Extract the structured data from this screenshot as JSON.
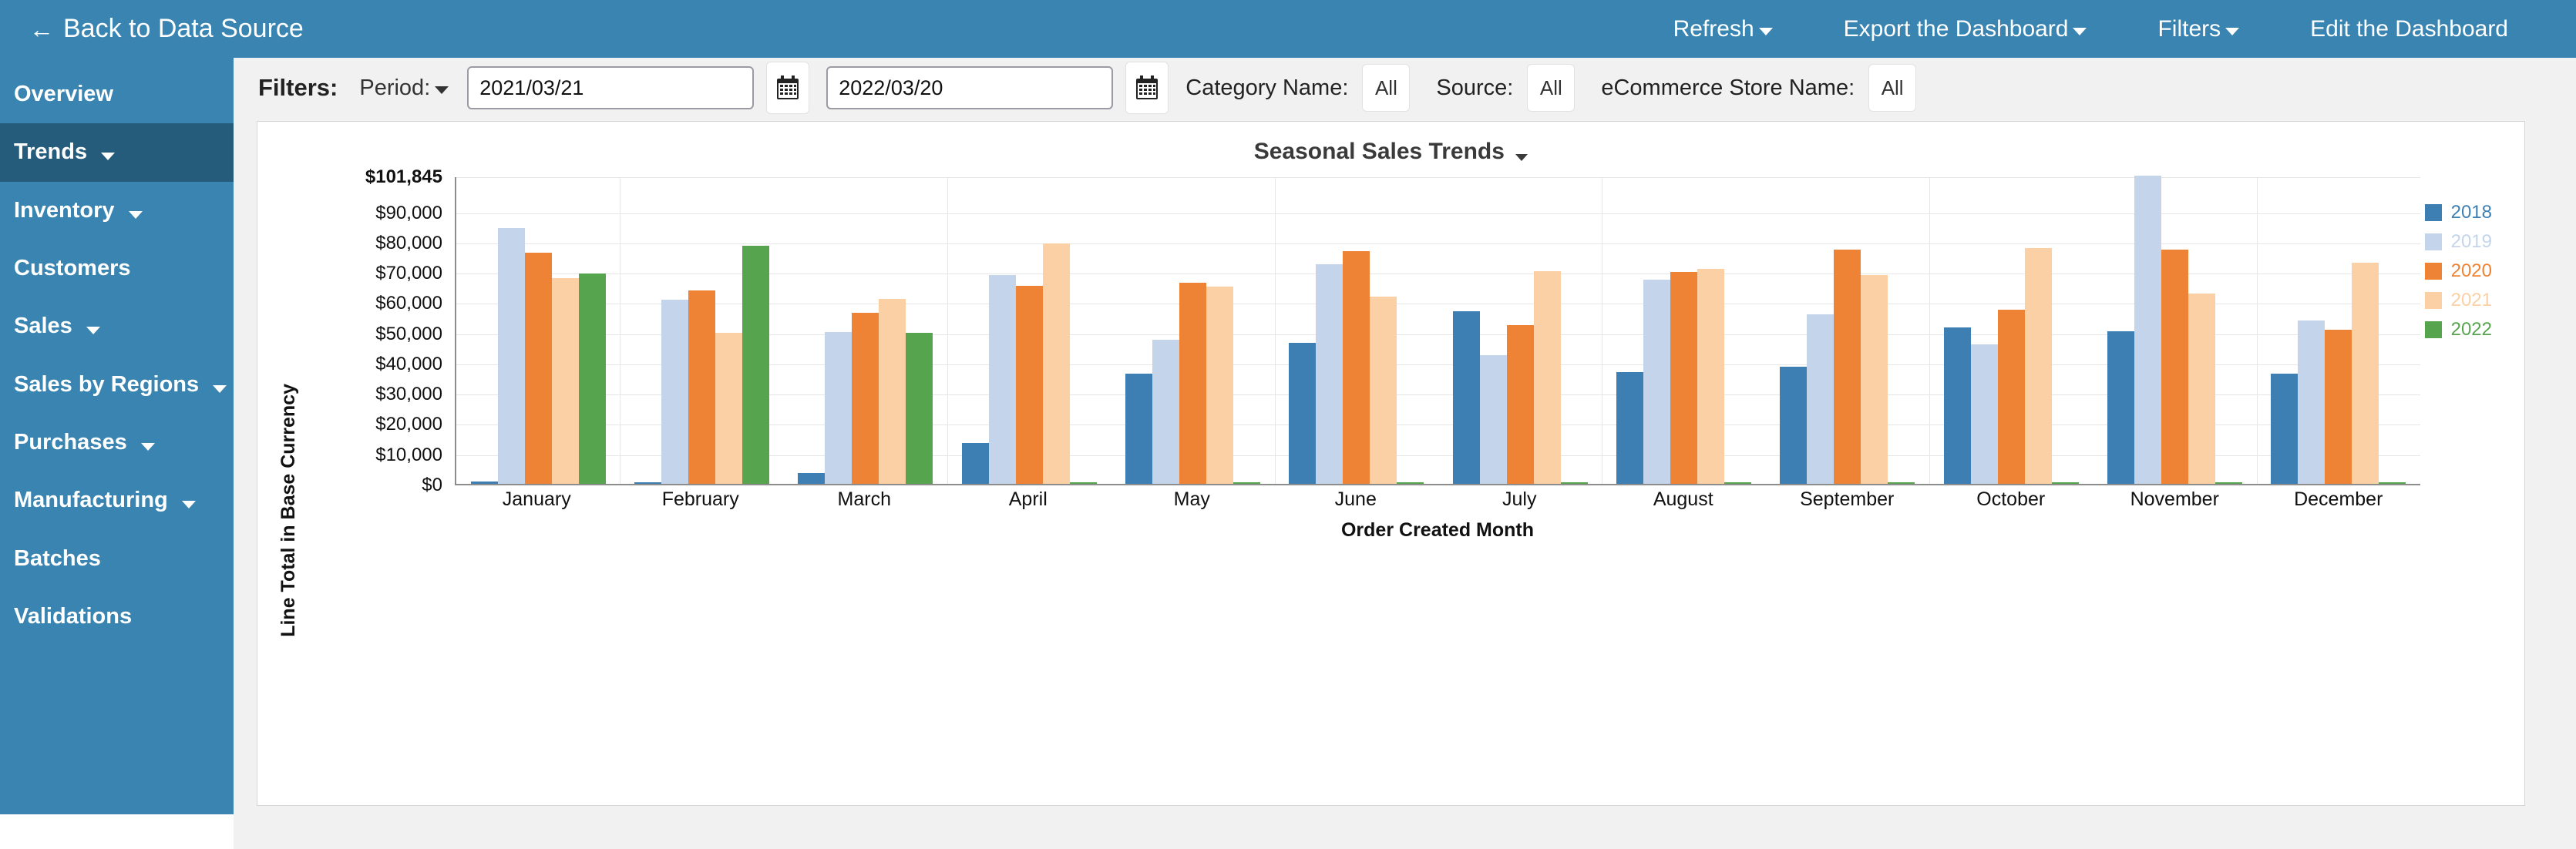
{
  "topbar": {
    "back_label": "Back to Data Source",
    "back_icon": "arrow-left-icon",
    "items": [
      {
        "label": "Refresh",
        "caret": true
      },
      {
        "label": "Export the Dashboard",
        "caret": true
      },
      {
        "label": "Filters",
        "caret": true
      },
      {
        "label": "Edit the Dashboard",
        "caret": false
      }
    ]
  },
  "sidebar": {
    "items": [
      {
        "label": "Overview",
        "caret": false,
        "active": false
      },
      {
        "label": "Trends",
        "caret": true,
        "active": true
      },
      {
        "label": "Inventory",
        "caret": true,
        "active": false
      },
      {
        "label": "Customers",
        "caret": false,
        "active": false
      },
      {
        "label": "Sales",
        "caret": true,
        "active": false
      },
      {
        "label": "Sales by Regions",
        "caret": true,
        "active": false
      },
      {
        "label": "Purchases",
        "caret": true,
        "active": false
      },
      {
        "label": "Manufacturing",
        "caret": true,
        "active": false
      },
      {
        "label": "Batches",
        "caret": false,
        "active": false
      },
      {
        "label": "Validations",
        "caret": false,
        "active": false
      }
    ]
  },
  "filters": {
    "title": "Filters:",
    "period_label": "Period:",
    "date_from": "2021/03/21",
    "date_to": "2022/03/20",
    "date_placeholder": "YYYY/MM/DD",
    "calendar_icon": "calendar-icon",
    "category_label": "Category Name:",
    "category_value": "All",
    "source_label": "Source:",
    "source_value": "All",
    "store_label": "eCommerce Store Name:",
    "store_value": "All"
  },
  "panel": {
    "title": "Seasonal Sales Trends"
  },
  "chart_data": {
    "type": "bar",
    "title": "Seasonal Sales Trends",
    "xlabel": "Order Created Month",
    "ylabel": "Line Total in Base Currency",
    "ylim": [
      0,
      101845
    ],
    "grid": true,
    "legend_position": "right",
    "ytick_labels": [
      "$101,845",
      "$90,000",
      "$80,000",
      "$70,000",
      "$60,000",
      "$50,000",
      "$40,000",
      "$30,000",
      "$20,000",
      "$10,000",
      "$0"
    ],
    "ytick_values": [
      101845,
      90000,
      80000,
      70000,
      60000,
      50000,
      40000,
      30000,
      20000,
      10000,
      0
    ],
    "categories": [
      "January",
      "February",
      "March",
      "April",
      "May",
      "June",
      "July",
      "August",
      "September",
      "October",
      "November",
      "December"
    ],
    "series": [
      {
        "name": "2018",
        "color": "#3d7fb3",
        "values": [
          700,
          600,
          3500,
          13500,
          36500,
          46500,
          57000,
          37000,
          38700,
          51800,
          50500,
          36500
        ]
      },
      {
        "name": "2019",
        "color": "#c3d4eb",
        "values": [
          84500,
          60800,
          50100,
          69000,
          47500,
          72500,
          42500,
          67500,
          56000,
          46000,
          101845,
          54000
        ]
      },
      {
        "name": "2020",
        "color": "#ee8336",
        "values": [
          76500,
          63800,
          56500,
          65400,
          66500,
          76800,
          52500,
          70000,
          77500,
          57500,
          77300,
          51000
        ]
      },
      {
        "name": "2021",
        "color": "#fad0a4",
        "values": [
          68100,
          50000,
          61000,
          79500,
          65300,
          62000,
          70300,
          71000,
          69000,
          78000,
          63000,
          73000
        ]
      },
      {
        "name": "2022",
        "color": "#56a44d",
        "values": [
          69500,
          78800,
          49800,
          600,
          500,
          500,
          500,
          500,
          500,
          500,
          500,
          400
        ]
      }
    ]
  }
}
